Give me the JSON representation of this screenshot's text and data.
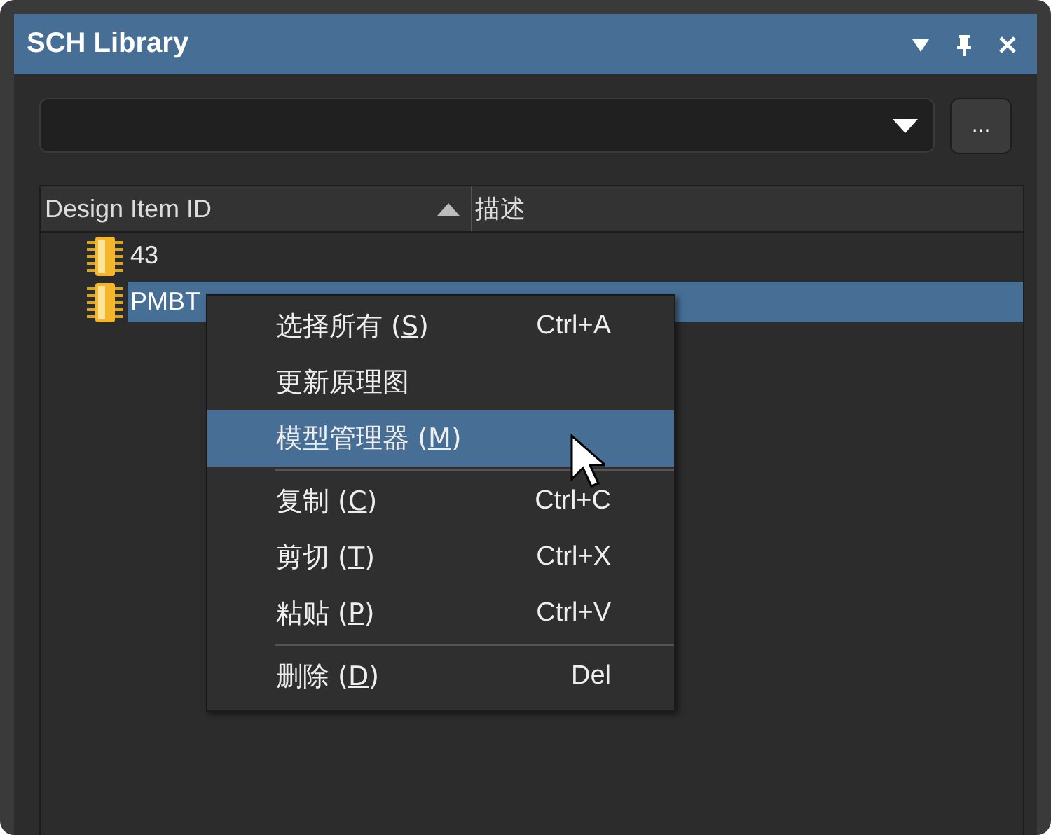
{
  "window": {
    "title": "SCH Library"
  },
  "title_buttons": [
    {
      "kind": "menu"
    },
    {
      "kind": "pin"
    },
    {
      "kind": "close"
    }
  ],
  "filter": {
    "browse_button": "..."
  },
  "table": {
    "columns": [
      {
        "label": "Design Item ID",
        "sort_ascending": true
      },
      {
        "label": "描述"
      }
    ],
    "rows": [
      {
        "name": "43",
        "selected": false
      },
      {
        "name": "PMBT",
        "selected": true
      }
    ]
  },
  "context_menu": {
    "items": [
      {
        "label_parts": [
          "选择所有 (",
          "S",
          ")"
        ],
        "shortcut": "Ctrl+A",
        "selected": false,
        "separator_after": false
      },
      {
        "label_parts": [
          "更新原理图"
        ],
        "selected": false,
        "separator_after": false
      },
      {
        "label_parts": [
          "模型管理器 (",
          "M",
          ")"
        ],
        "selected": true,
        "separator_after": true
      },
      {
        "label_parts": [
          "复制 (",
          "C",
          ")"
        ],
        "shortcut": "Ctrl+C",
        "selected": false,
        "separator_after": false
      },
      {
        "label_parts": [
          "剪切 (",
          "T",
          ")"
        ],
        "shortcut": "Ctrl+X",
        "selected": false,
        "separator_after": false
      },
      {
        "label_parts": [
          "粘贴 (",
          "P",
          ")"
        ],
        "shortcut": "Ctrl+V",
        "selected": false,
        "separator_after": true
      },
      {
        "label_parts": [
          "删除 (",
          "D",
          ")"
        ],
        "shortcut": "Del",
        "selected": false,
        "separator_after": false
      }
    ]
  }
}
